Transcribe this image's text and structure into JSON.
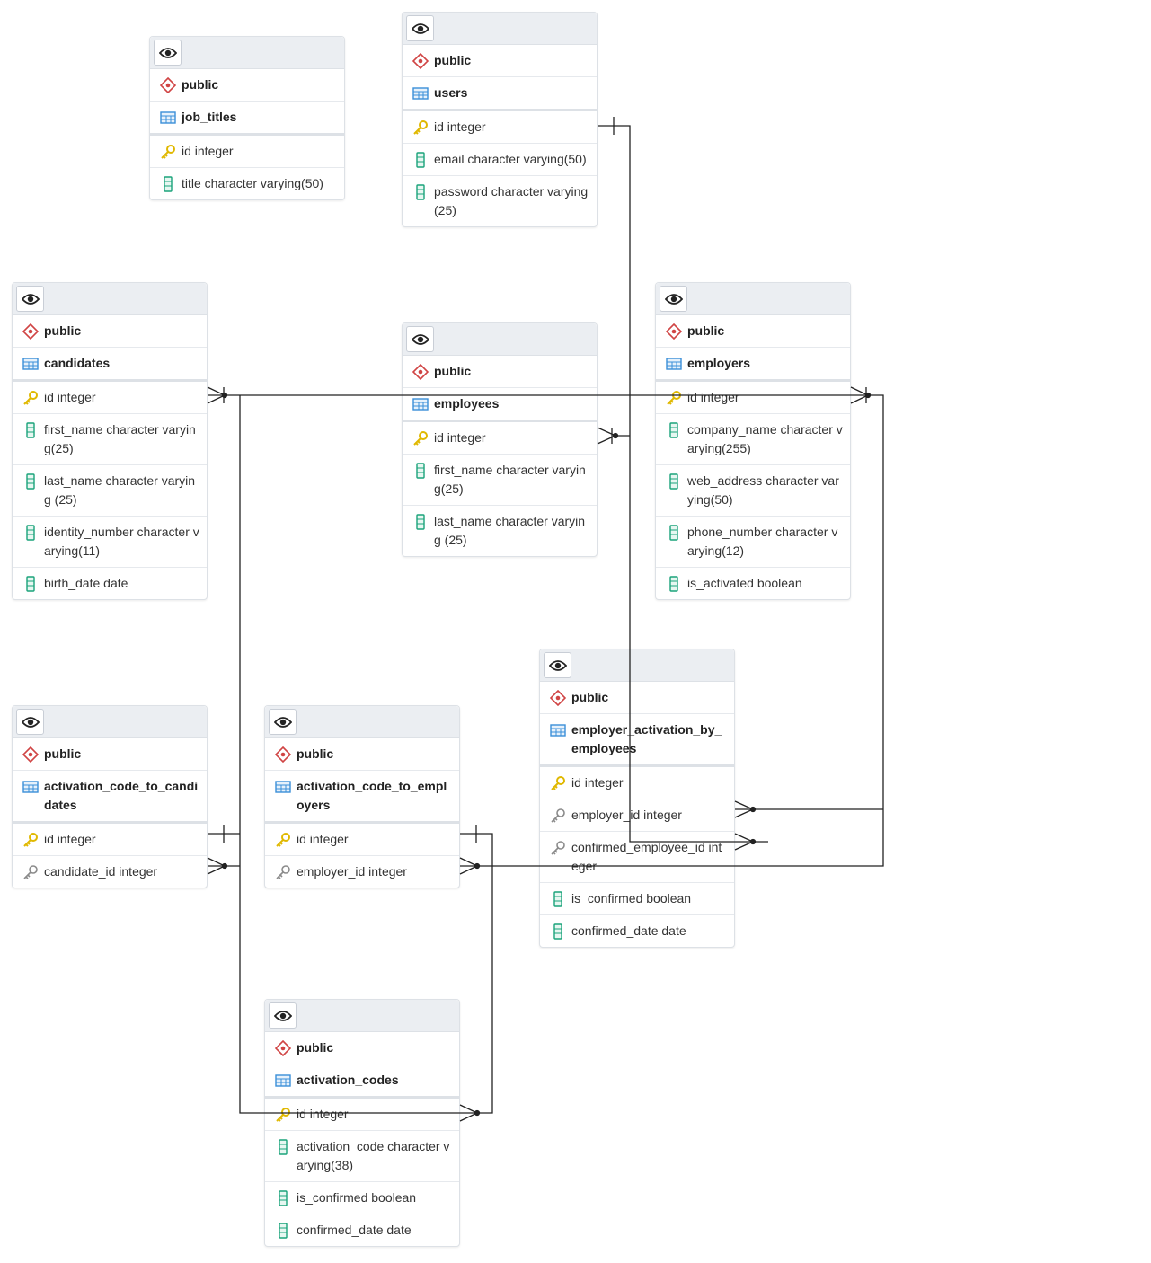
{
  "colors": {
    "schema": "#d04444",
    "table": "#3a8fd8",
    "pk": "#e0b800",
    "fk": "#8a8a8a",
    "column": "#1aa37a",
    "line": "#222222"
  },
  "tables": [
    {
      "id": "job_titles",
      "schema": "public",
      "name": "job_titles",
      "columns": [
        {
          "text": "id integer",
          "kind": "pk"
        },
        {
          "text": "title character varying(50)",
          "kind": "column"
        }
      ]
    },
    {
      "id": "users",
      "schema": "public",
      "name": "users",
      "columns": [
        {
          "text": "id integer",
          "kind": "pk"
        },
        {
          "text": "email character varying(50)",
          "kind": "column"
        },
        {
          "text": "password character varying (25)",
          "kind": "column"
        }
      ]
    },
    {
      "id": "candidates",
      "schema": "public",
      "name": "candidates",
      "columns": [
        {
          "text": "id integer",
          "kind": "pk"
        },
        {
          "text": "first_name character varying(25)",
          "kind": "column"
        },
        {
          "text": "last_name character varying (25)",
          "kind": "column"
        },
        {
          "text": "identity_number character varying(11)",
          "kind": "column"
        },
        {
          "text": "birth_date date",
          "kind": "column"
        }
      ]
    },
    {
      "id": "employees",
      "schema": "public",
      "name": "employees",
      "columns": [
        {
          "text": "id integer",
          "kind": "pk"
        },
        {
          "text": "first_name character varying(25)",
          "kind": "column"
        },
        {
          "text": "last_name character varying (25)",
          "kind": "column"
        }
      ]
    },
    {
      "id": "employers",
      "schema": "public",
      "name": "employers",
      "columns": [
        {
          "text": "id integer",
          "kind": "pk"
        },
        {
          "text": "company_name character varying(255)",
          "kind": "column"
        },
        {
          "text": "web_address character varying(50)",
          "kind": "column"
        },
        {
          "text": "phone_number character varying(12)",
          "kind": "column"
        },
        {
          "text": "is_activated boolean",
          "kind": "column"
        }
      ]
    },
    {
      "id": "employer_activation_by_employees",
      "schema": "public",
      "name": "employer_activation_by_employees",
      "columns": [
        {
          "text": "id integer",
          "kind": "pk"
        },
        {
          "text": "employer_id integer",
          "kind": "fk"
        },
        {
          "text": "confirmed_employee_id integer",
          "kind": "fk"
        },
        {
          "text": "is_confirmed boolean",
          "kind": "column"
        },
        {
          "text": "confirmed_date date",
          "kind": "column"
        }
      ]
    },
    {
      "id": "activation_code_to_candidates",
      "schema": "public",
      "name": "activation_code_to_candidates",
      "columns": [
        {
          "text": "id integer",
          "kind": "pk"
        },
        {
          "text": "candidate_id integer",
          "kind": "fk"
        }
      ]
    },
    {
      "id": "activation_code_to_employers",
      "schema": "public",
      "name": "activation_code_to_employers",
      "columns": [
        {
          "text": "id integer",
          "kind": "pk"
        },
        {
          "text": "employer_id integer",
          "kind": "fk"
        }
      ]
    },
    {
      "id": "activation_codes",
      "schema": "public",
      "name": "activation_codes",
      "columns": [
        {
          "text": "id integer",
          "kind": "pk"
        },
        {
          "text": "activation_code character varying(38)",
          "kind": "column"
        },
        {
          "text": "is_confirmed boolean",
          "kind": "column"
        },
        {
          "text": "confirmed_date date",
          "kind": "column"
        }
      ]
    }
  ]
}
